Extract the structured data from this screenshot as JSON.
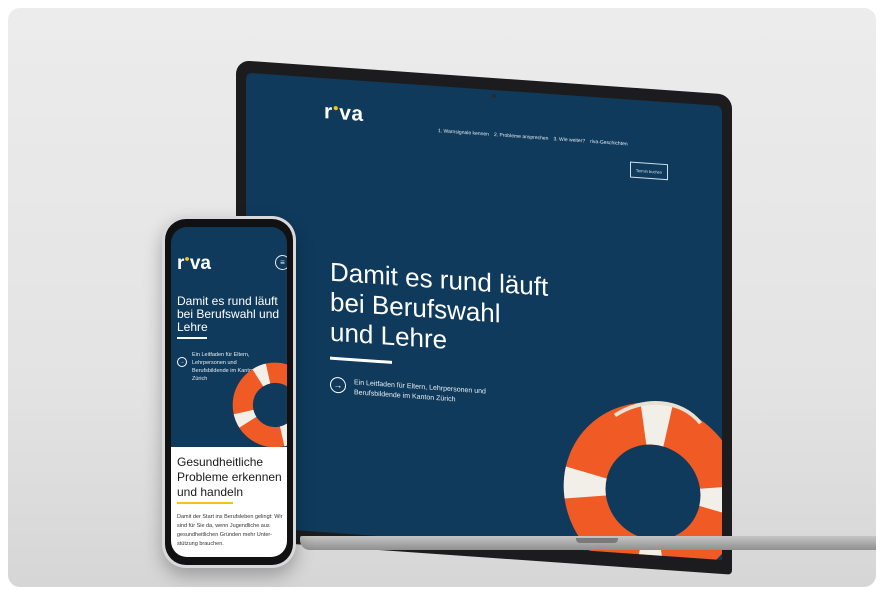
{
  "brand": {
    "logo_text": "r•va",
    "accent_color": "#f0c419",
    "primary_color": "#0f3a5c"
  },
  "laptop": {
    "nav": [
      "1. Warnsignale kennen",
      "2. Probleme ansprechen",
      "3. Wie weiter?",
      "riva-Geschichten"
    ],
    "nav_button": "Termin buchen",
    "hero_title": "Damit es rund läuft bei Berufswahl und Lehre",
    "hero_cta": "Ein Leitfaden für Eltern, Lehrpersonen und Berufsbildende im Kanton Zürich"
  },
  "phone": {
    "hero_title": "Damit es rund läuft bei Berufswahl und Lehre",
    "hero_cta": "Ein Leitfaden für Eltern, Lehrpersonen und Berufsbildende im Kanton Zürich",
    "card_title": "Gesundheitliche Probleme erkennen und handeln",
    "card_text": "Damit der Start ins Berufsleben gelingt: Wir sind für Sie da, wenn Jugendliche aus gesundheitlichen Gründen mehr Unter-stützung brauchen.",
    "icons": {
      "menu": "menu-icon",
      "arrow": "arrow-right-icon"
    }
  }
}
